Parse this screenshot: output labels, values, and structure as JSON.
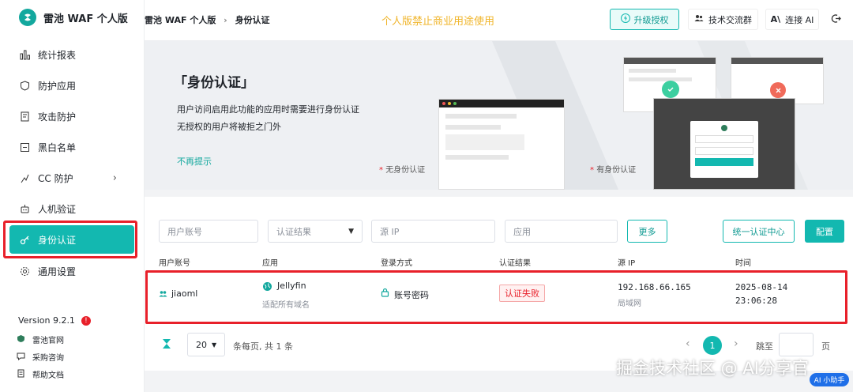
{
  "app": {
    "title": "雷池 WAF 个人版",
    "version": "Version 9.2.1",
    "version_badge": "!",
    "colors": {
      "accent": "#13b8b0",
      "highlight": "#e8202a",
      "notice": "#f0b52b"
    }
  },
  "sidebar": {
    "items": [
      {
        "label": "统计报表",
        "icon": "chart-icon"
      },
      {
        "label": "防护应用",
        "icon": "shield-icon"
      },
      {
        "label": "攻击防护",
        "icon": "attack-icon"
      },
      {
        "label": "黑白名单",
        "icon": "list-icon"
      },
      {
        "label": "CC 防护",
        "icon": "cc-icon",
        "has_submenu": true
      },
      {
        "label": "人机验证",
        "icon": "robot-icon"
      },
      {
        "label": "身份认证",
        "icon": "key-icon",
        "active": true
      },
      {
        "label": "通用设置",
        "icon": "gear-icon"
      }
    ],
    "footer_links": [
      {
        "label": "雷池官网",
        "icon": "website-icon"
      },
      {
        "label": "采购咨询",
        "icon": "chat-icon"
      },
      {
        "label": "帮助文档",
        "icon": "doc-icon"
      }
    ]
  },
  "header": {
    "breadcrumb": [
      "雷池 WAF 个人版",
      "身份认证"
    ],
    "breadcrumb_sep": "›",
    "notice": "个人版禁止商业用途使用",
    "upgrade_label": "升级授权",
    "community_label": "技术交流群",
    "ai_label": "连接 AI"
  },
  "banner": {
    "title": "「身份认证」",
    "desc_line1": "用户访问启用此功能的应用时需要进行身份认证",
    "desc_line2": "无授权的用户将被拒之门外",
    "dismiss_link": "不再提示",
    "caption_left": "无身份认证",
    "caption_right": "有身份认证",
    "caption_star": "*"
  },
  "filters": {
    "user_placeholder": "用户账号",
    "result_placeholder": "认证结果",
    "ip_placeholder": "源 IP",
    "app_placeholder": "应用",
    "more_label": "更多",
    "sso_label": "统一认证中心",
    "config_label": "配置"
  },
  "table": {
    "headers": [
      "用户账号",
      "应用",
      "登录方式",
      "认证结果",
      "源 IP",
      "时间"
    ],
    "rows": [
      {
        "user": "jiaoml",
        "app_name": "Jellyfin",
        "app_sub": "适配所有域名",
        "login_method": "账号密码",
        "result": "认证失败",
        "ip": "192.168.66.165",
        "ip_sub": "局域网",
        "date": "2025-08-14",
        "time": "23:06:28"
      }
    ]
  },
  "pager": {
    "page_size": "20",
    "summary": "条每页, 共 1 条",
    "current_page": "1",
    "prev": "‹",
    "next": "›",
    "jump_label": "跳至",
    "jump_suffix": "页"
  },
  "overlay": {
    "watermark": "掘金技术社区 @ AI分享官",
    "ai_assistant": "AI 小助手"
  }
}
